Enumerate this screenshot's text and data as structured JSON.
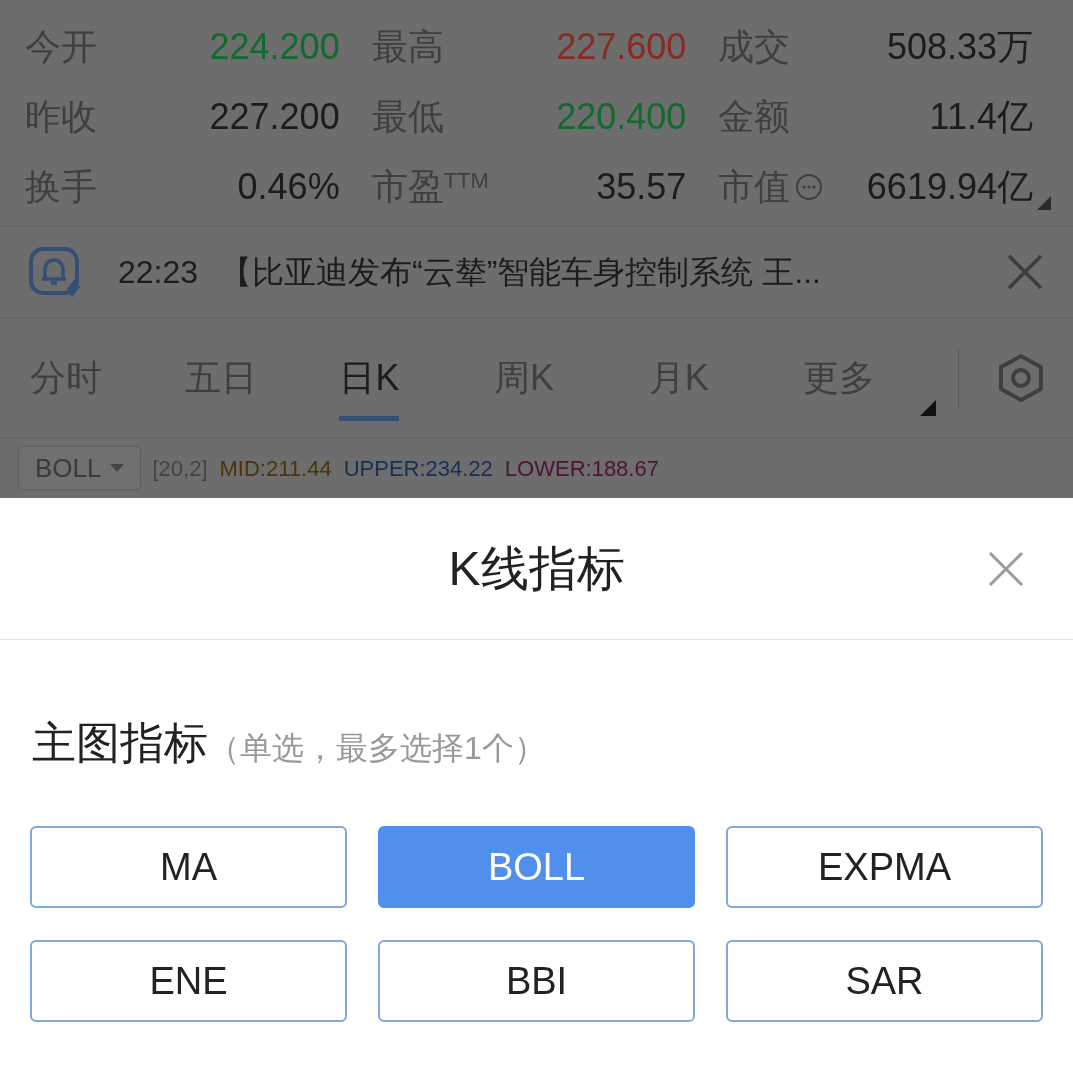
{
  "quote": {
    "items": [
      {
        "label": "今开",
        "value": "224.200",
        "color": "#0f6b2e"
      },
      {
        "label": "最高",
        "value": "227.600",
        "color": "#8a2a22"
      },
      {
        "label": "成交",
        "value": "508.33万",
        "color": "#1c1c1c"
      },
      {
        "label": "昨收",
        "value": "227.200",
        "color": "#1c1c1c"
      },
      {
        "label": "最低",
        "value": "220.400",
        "color": "#0f6b2e"
      },
      {
        "label": "金额",
        "value": "11.4亿",
        "color": "#1c1c1c"
      },
      {
        "label": "换手",
        "value": "0.46%",
        "color": "#1c1c1c"
      },
      {
        "label": "市盈$^{TTM}$",
        "value": "35.57",
        "color": "#1c1c1c"
      },
      {
        "label": "市值",
        "value": "6619.94亿",
        "color": "#1c1c1c",
        "info_icon": true
      }
    ]
  },
  "news": {
    "time": "22:23",
    "text": "【比亚迪发布“云辇”智能车身控制系统 王..."
  },
  "period_tabs": [
    {
      "label": "分时",
      "selected": false,
      "kind": "plain"
    },
    {
      "label": "五日",
      "selected": false,
      "kind": "plain"
    },
    {
      "label": "日K",
      "selected": true,
      "kind": "plain"
    },
    {
      "label": "周K",
      "selected": false,
      "kind": "plain"
    },
    {
      "label": "月K",
      "selected": false,
      "kind": "plain"
    },
    {
      "label": "更多",
      "selected": false,
      "kind": "dropdown"
    }
  ],
  "indicator_bar": {
    "indicator": "BOLL",
    "params": "[20,2]",
    "values": [
      {
        "text": "MID:211.44",
        "color": "#4a3505"
      },
      {
        "text": "UPPER:234.22",
        "color": "#182f55"
      },
      {
        "text": "LOWER:188.67",
        "color": "#4e1238"
      }
    ]
  },
  "sheet": {
    "title": "K线指标",
    "section": "主图指标",
    "note": "（单选，最多选择1个）",
    "options": [
      {
        "label": "MA",
        "selected": false
      },
      {
        "label": "BOLL",
        "selected": true
      },
      {
        "label": "EXPMA",
        "selected": false
      },
      {
        "label": "ENE",
        "selected": false
      },
      {
        "label": "BBI",
        "selected": false
      },
      {
        "label": "SAR",
        "selected": false
      }
    ]
  }
}
